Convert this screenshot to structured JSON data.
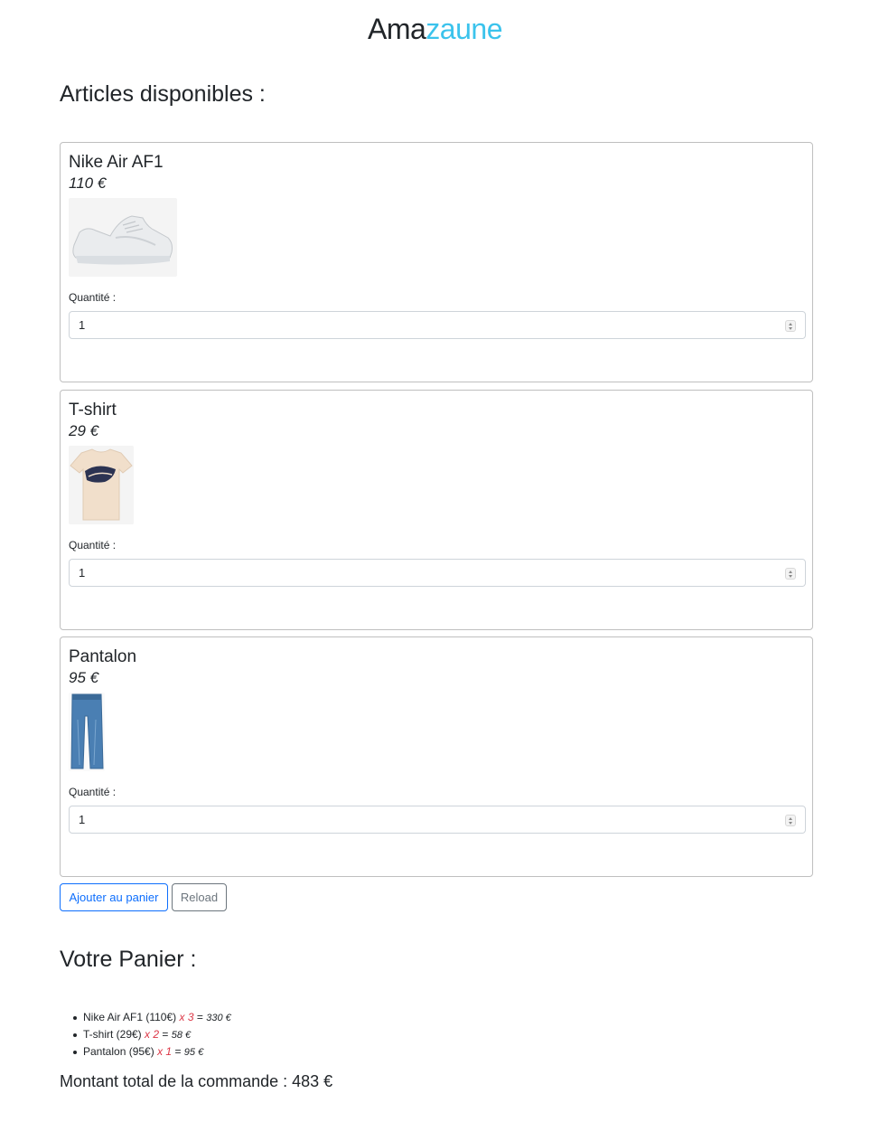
{
  "brand": {
    "part1": "Ama",
    "part2": "zaune"
  },
  "articles_title": "Articles disponibles :",
  "products": [
    {
      "name": "Nike Air AF1",
      "price": "110 €",
      "qty_label": "Quantité :",
      "qty_value": "1",
      "image": "sneaker-image"
    },
    {
      "name": "T-shirt",
      "price": "29 €",
      "qty_label": "Quantité :",
      "qty_value": "1",
      "image": "tshirt-image"
    },
    {
      "name": "Pantalon",
      "price": "95 €",
      "qty_label": "Quantité :",
      "qty_value": "1",
      "image": "jeans-image"
    }
  ],
  "buttons": {
    "add_to_cart": "Ajouter au panier",
    "reload": "Reload"
  },
  "cart_title": "Votre Panier :",
  "cart_items": [
    {
      "label": "Nike Air AF1 (110€)",
      "multiplier": "x 3",
      "equals": "=",
      "subtotal": "330 €"
    },
    {
      "label": "T-shirt (29€)",
      "multiplier": "x 2",
      "equals": "=",
      "subtotal": "58 €"
    },
    {
      "label": "Pantalon (95€)",
      "multiplier": "x 1",
      "equals": "=",
      "subtotal": "95 €"
    }
  ],
  "total": "Montant total de la commande : 483 €",
  "colors": {
    "brand_accent": "#3bc3ec",
    "primary": "#0d6efd",
    "secondary": "#6c757d",
    "multiplier": "#dc3545"
  }
}
